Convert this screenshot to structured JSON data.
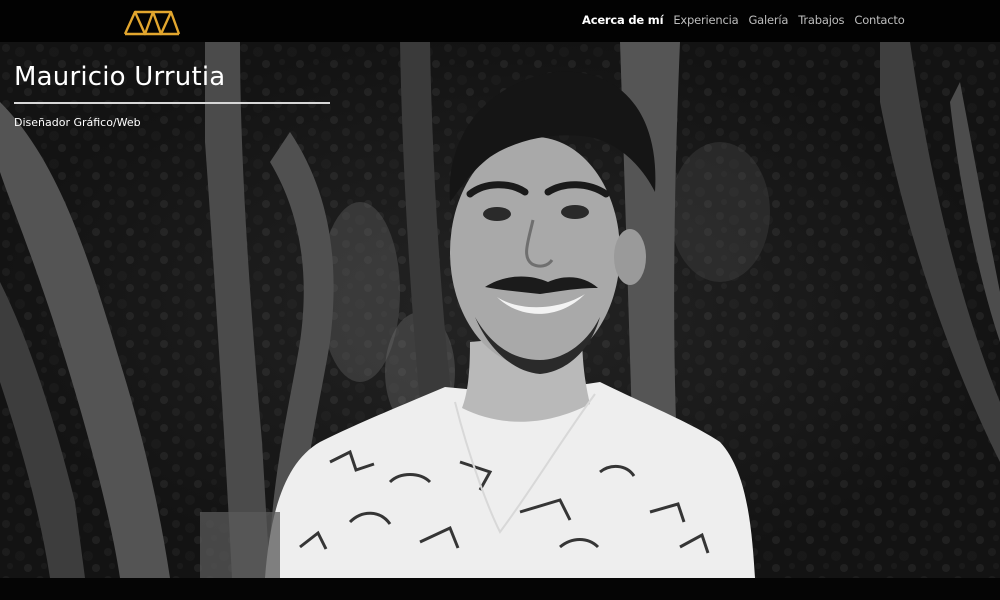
{
  "nav": {
    "items": [
      {
        "label": "Acerca de mí",
        "active": true
      },
      {
        "label": "Experiencia",
        "active": false
      },
      {
        "label": "Galería",
        "active": false
      },
      {
        "label": "Trabajos",
        "active": false
      },
      {
        "label": "Contacto",
        "active": false
      }
    ]
  },
  "hero": {
    "name": "Mauricio Urrutia",
    "subtitle": "Diseñador Gráfico/Web"
  },
  "colors": {
    "logo_accent": "#e2a62e",
    "bar": "#020202"
  }
}
